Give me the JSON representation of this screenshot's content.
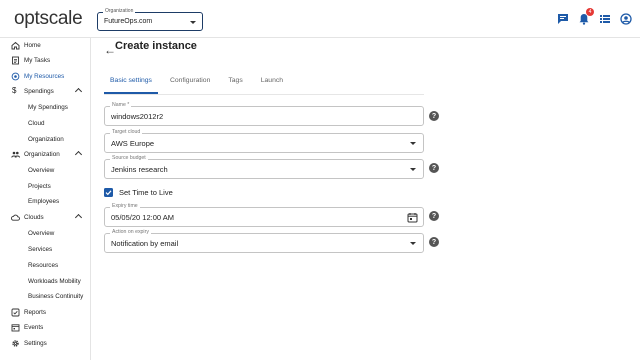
{
  "app": {
    "logo_text": "optscale"
  },
  "organization_select": {
    "label": "Organization",
    "value": "FutureOps.com"
  },
  "top_icons": {
    "notification_count": "4"
  },
  "sidebar": {
    "items": [
      {
        "label": "Home",
        "icon": "home-icon"
      },
      {
        "label": "My Tasks",
        "icon": "tasks-icon"
      },
      {
        "label": "My Resources",
        "icon": "resources-icon",
        "active": true
      },
      {
        "label": "Spendings",
        "icon": "dollar-icon",
        "expandable": true
      },
      {
        "label": "My Spendings",
        "sub": true
      },
      {
        "label": "Cloud",
        "sub": true
      },
      {
        "label": "Organization",
        "sub": true
      },
      {
        "label": "Organization",
        "icon": "people-icon",
        "expandable": true
      },
      {
        "label": "Overview",
        "sub": true
      },
      {
        "label": "Projects",
        "sub": true
      },
      {
        "label": "Employees",
        "sub": true
      },
      {
        "label": "Clouds",
        "icon": "cloud-icon",
        "expandable": true
      },
      {
        "label": "Overview",
        "sub": true
      },
      {
        "label": "Services",
        "sub": true
      },
      {
        "label": "Resources",
        "sub": true
      },
      {
        "label": "Workloads Mobility",
        "sub": true
      },
      {
        "label": "Business Continuity",
        "sub": true
      },
      {
        "label": "Reports",
        "icon": "reports-icon"
      },
      {
        "label": "Events",
        "icon": "events-icon"
      },
      {
        "label": "Settings",
        "icon": "gear-icon"
      }
    ]
  },
  "page": {
    "title": "Create instance",
    "tabs": [
      {
        "label": "Basic settings",
        "active": true
      },
      {
        "label": "Configuration"
      },
      {
        "label": "Tags"
      },
      {
        "label": "Launch"
      }
    ]
  },
  "form": {
    "name": {
      "label": "Name *",
      "value": "windows2012r2"
    },
    "target_cloud": {
      "label": "Target cloud",
      "value": "AWS Europe"
    },
    "source_budget": {
      "label": "Source budget",
      "value": "Jenkins research"
    },
    "ttl": {
      "label": "Set Time to Live",
      "checked": true
    },
    "expiry_time": {
      "label": "Expiry time",
      "value": "05/05/20 12:00 AM"
    },
    "action_on_expiry": {
      "label": "Action on expiry",
      "value": "Notification by email"
    },
    "help_glyph": "?"
  },
  "colors": {
    "accent": "#1e5aa8",
    "badge": "#e53935"
  }
}
